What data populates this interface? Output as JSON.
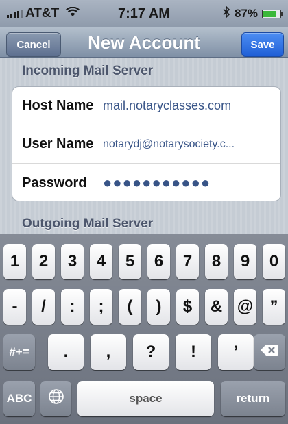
{
  "status_bar": {
    "carrier": "AT&T",
    "time": "7:17 AM",
    "battery_label": "87%",
    "battery_level": 0.87,
    "battery_color": "#3bb83b",
    "icons": [
      "signal-icon",
      "wifi-icon",
      "bluetooth-icon",
      "battery-icon"
    ]
  },
  "nav": {
    "title": "New Account",
    "cancel_label": "Cancel",
    "save_label": "Save",
    "save_color": "#2f73e6"
  },
  "incoming": {
    "header": "Incoming Mail Server",
    "fields": [
      {
        "label": "Host Name",
        "value": "mail.notaryclasses.com"
      },
      {
        "label": "User Name",
        "value": "notarydj@notarysociety.c..."
      },
      {
        "label": "Password",
        "value": "●●●●●●●●●●●"
      }
    ]
  },
  "outgoing": {
    "header": "Outgoing Mail Server"
  },
  "keyboard": {
    "row1": [
      "1",
      "2",
      "3",
      "4",
      "5",
      "6",
      "7",
      "8",
      "9",
      "0"
    ],
    "row2": [
      "-",
      "/",
      ":",
      ";",
      "(",
      ")",
      "$",
      "&",
      "@",
      "”"
    ],
    "row3": [
      "#+=",
      ".",
      ",",
      "?",
      "!",
      "’"
    ],
    "row4": {
      "abc": "ABC",
      "space": "space",
      "return": "return"
    },
    "icons": [
      "globe-icon",
      "backspace-icon"
    ]
  }
}
